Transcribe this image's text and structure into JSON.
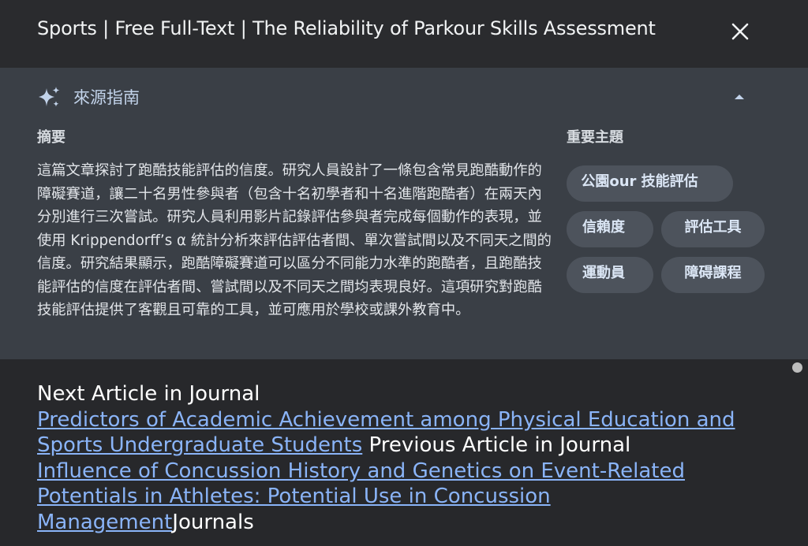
{
  "header": {
    "title": "Sports | Free Full-Text | The Reliability of Parkour Skills Assessment"
  },
  "source_guide": {
    "title": "來源指南",
    "summary_label": "摘要",
    "summary_text": "這篇文章探討了跑酷技能評估的信度。研究人員設計了一條包含常見跑酷動作的障礙賽道，讓二十名男性參與者（包含十名初學者和十名進階跑酷者）在兩天內分別進行三次嘗試。研究人員利用影片記錄評估參與者完成每個動作的表現，並使用 Krippendorff’s α 統計分析來評估評估者間、單次嘗試間以及不同天之間的信度。研究結果顯示，跑酷障礙賽道可以區分不同能力水準的跑酷者，且跑酷技能評估的信度在評估者間、嘗試間以及不同天之間均表現良好。這項研究對跑酷技能評估提供了客觀且可靠的工具，並可應用於學校或課外教育中。",
    "topics_label": "重要主題",
    "topics": [
      "公園our 技能評估",
      "信賴度",
      "評估工具",
      "運動員",
      "障碍課程"
    ]
  },
  "articles": {
    "next_label": "Next Article in Journal",
    "next_link": "Predictors of Academic Achievement among Physical Education and Sports Undergraduate Students",
    "previous_label": "Previous Article in Journal",
    "previous_link": "Influence of Concussion History and Genetics on Event-Related Potentials in Athletes: Potential Use in Concussion Management",
    "journals_label": "Journals"
  },
  "colors": {
    "header_bg": "#2a2b2e",
    "guide_bg": "#3a3f46",
    "chip_bg": "#4d535c",
    "link": "#8ab4f8"
  },
  "icons": [
    "sparkle-icon",
    "close-icon",
    "chevron-up-icon"
  ]
}
